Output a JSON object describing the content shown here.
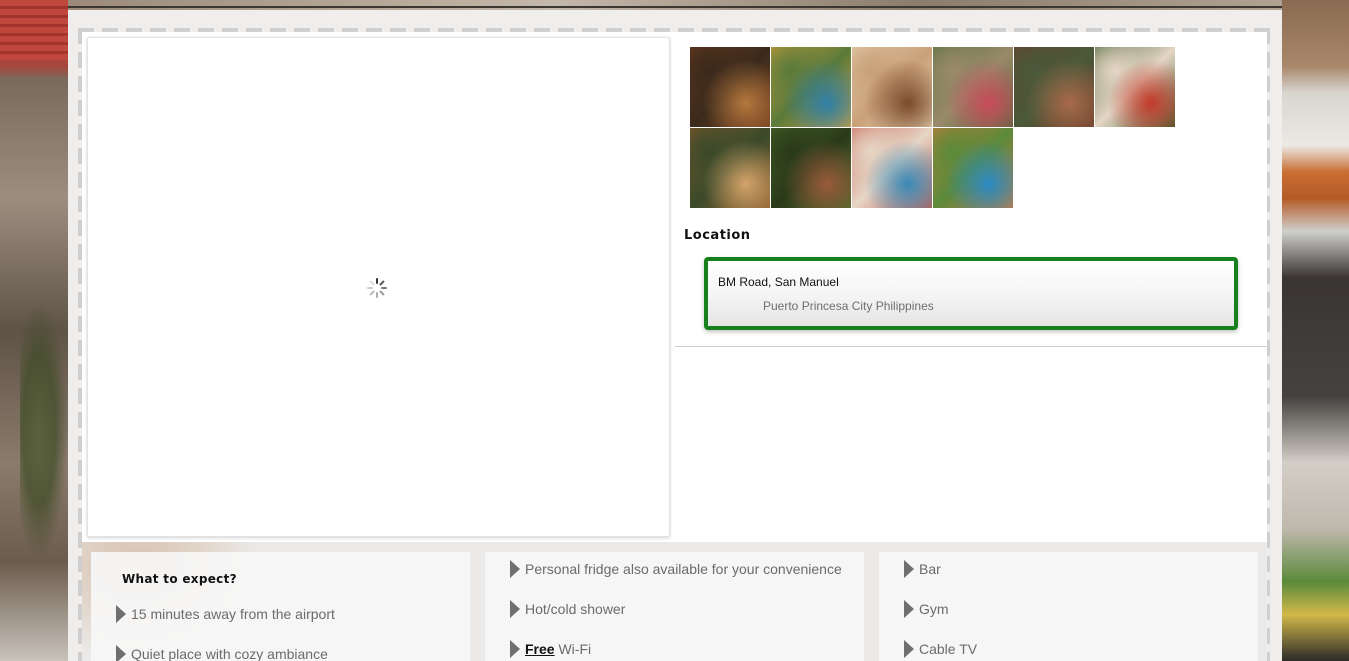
{
  "gallery": {
    "thumbnails": [
      {
        "alt": "hotel-facade",
        "colors": [
          "#6e3a1c",
          "#b5773d",
          "#3a2a1c"
        ]
      },
      {
        "alt": "pool-yellow-building",
        "colors": [
          "#d9a43a",
          "#2f7fa8",
          "#5a7a3a"
        ]
      },
      {
        "alt": "restaurant-interior",
        "colors": [
          "#e9d7b8",
          "#7a4a2a",
          "#c9a078"
        ]
      },
      {
        "alt": "garden-umbrellas",
        "colors": [
          "#4e6a3a",
          "#c94a5a",
          "#9a8a6a"
        ]
      },
      {
        "alt": "corridor-lights",
        "colors": [
          "#6a3a2a",
          "#a86a4a",
          "#4a5a3a"
        ]
      },
      {
        "alt": "rooftop-red",
        "colors": [
          "#3a5a2a",
          "#c43a2a",
          "#e5d5c5"
        ]
      },
      {
        "alt": "lounge-area",
        "colors": [
          "#8a5a2a",
          "#d4a46a",
          "#3a4a2a"
        ]
      },
      {
        "alt": "palm-stairs",
        "colors": [
          "#4a6a2a",
          "#9a5a3a",
          "#2a3a1a"
        ]
      },
      {
        "alt": "pool-cottage",
        "colors": [
          "#c45a4a",
          "#3a8ab8",
          "#e6d6c6"
        ]
      },
      {
        "alt": "pool-orange-building",
        "colors": [
          "#d47a3a",
          "#2a8ac4",
          "#5a8a3a"
        ]
      }
    ]
  },
  "location": {
    "heading": "Location",
    "address_line1": "BM Road, San Manuel",
    "address_line2": "Puerto Princesa City Philippines"
  },
  "features": {
    "heading": "What to expect?",
    "col1": [
      "15 minutes away from the airport",
      "Quiet place with cozy ambiance"
    ],
    "col2": [
      "Personal fridge also available for your convenience",
      "Hot/cold shower"
    ],
    "col2_free_word": "Free",
    "col2_wifi": " Wi-Fi",
    "col3": [
      "Bar",
      "Gym",
      "Cable TV"
    ]
  },
  "colors": {
    "location_border": "#16801c",
    "bullet": "#6f6f6f",
    "text_muted": "#6b6b6b"
  }
}
